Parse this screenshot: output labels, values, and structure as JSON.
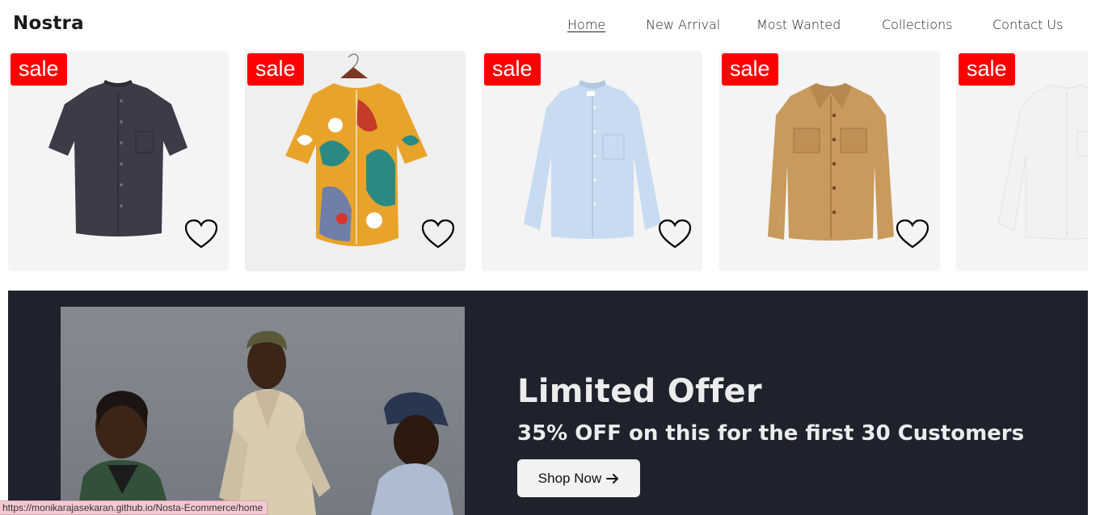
{
  "header": {
    "logo": "Nostra",
    "nav": [
      {
        "label": "Home",
        "active": true
      },
      {
        "label": "New Arrival",
        "active": false
      },
      {
        "label": "Most Wanted",
        "active": false
      },
      {
        "label": "Collections",
        "active": false
      },
      {
        "label": "Contact Us",
        "active": false
      }
    ]
  },
  "products": [
    {
      "badge": "sale",
      "icon": "heart-outline-icon",
      "shirt_color": "#3c3c48"
    },
    {
      "badge": "sale",
      "icon": "heart-outline-icon",
      "shirt_color": "#e8a32a"
    },
    {
      "badge": "sale",
      "icon": "heart-outline-icon",
      "shirt_color": "#c9dbf0"
    },
    {
      "badge": "sale",
      "icon": "heart-outline-icon",
      "shirt_color": "#c89a5c"
    },
    {
      "badge": "sale",
      "icon": "heart-outline-icon",
      "shirt_color": "#f2f2f2"
    }
  ],
  "banner": {
    "title": "Limited Offer",
    "subtitle": "35% OFF on this for the first 30 Customers",
    "button_label": "Shop Now",
    "button_icon": "arrow-right-icon"
  },
  "status_bar": {
    "url": "https://monikarajasekaran.github.io/Nosta-Ecommerce/home"
  },
  "colors": {
    "sale_badge": "#ff0000",
    "banner_bg": "#1e222d",
    "card_bg": "#f4f4f4"
  }
}
